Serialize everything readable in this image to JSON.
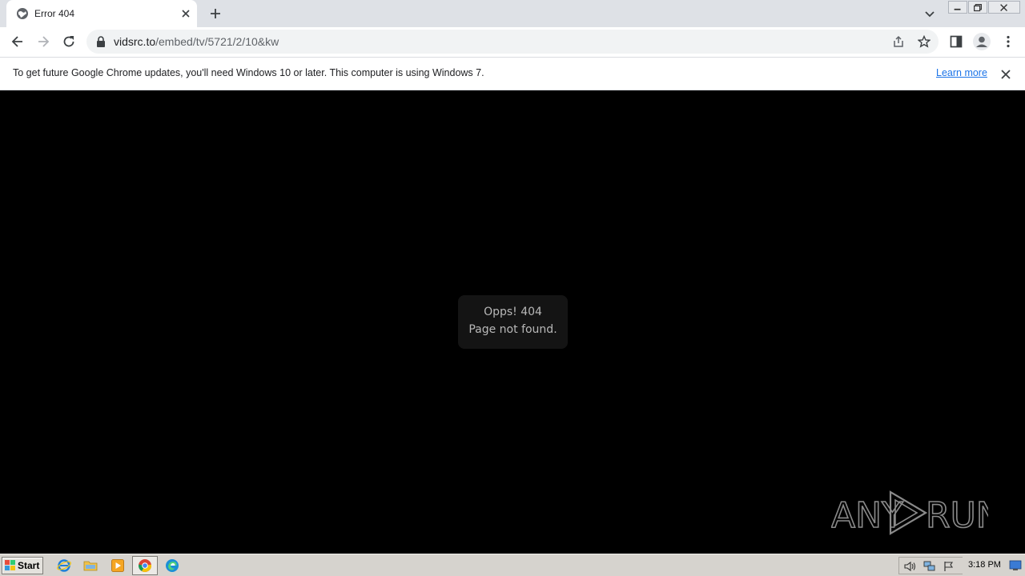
{
  "browser": {
    "tab": {
      "title": "Error 404",
      "favicon": "globe-icon"
    },
    "url": {
      "host": "vidsrc.to",
      "path": "/embed/tv/5721/2/10&kw"
    },
    "toolbar_icons": [
      "back-icon",
      "forward-icon",
      "reload-icon",
      "share-icon",
      "star-icon",
      "side-panel-icon",
      "profile-icon",
      "menu-icon"
    ]
  },
  "infobar": {
    "message": "To get future Google Chrome updates, you'll need Windows 10 or later. This computer is using Windows 7.",
    "link": "Learn more"
  },
  "page": {
    "error_line1": "Opps! 404",
    "error_line2": "Page not found.",
    "watermark_brand": "ANY.RUN"
  },
  "taskbar": {
    "start_label": "Start",
    "clock": "3:18 PM"
  },
  "colors": {
    "accent_link": "#1a73e8",
    "page_background": "#000000",
    "error_box": "#141414"
  }
}
